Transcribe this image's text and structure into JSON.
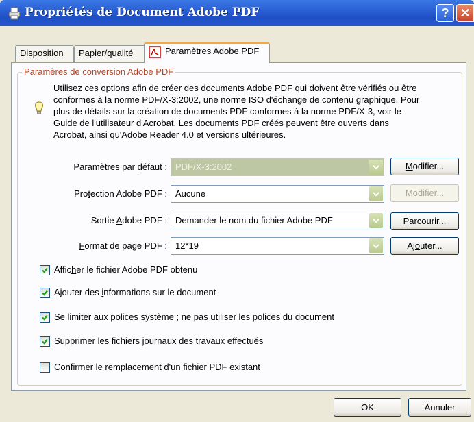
{
  "window": {
    "title": "Propriétés de Document Adobe PDF",
    "help_label": "?",
    "close_label": "✕"
  },
  "tabs": [
    {
      "label": "Disposition"
    },
    {
      "label": "Papier/qualité"
    },
    {
      "label": "Paramètres Adobe PDF",
      "active": true
    }
  ],
  "group": {
    "legend": "Paramères de conversion Adobe PDF",
    "info_lines": [
      "Utilisez ces options afin de créer des documents Adobe PDF qui doivent être vérifiés ou être",
      "conformes à la norme PDF/X-3:2002, une norme ISO d'échange de contenu graphique. Pour",
      "plus de détails sur la création de documents PDF conformes à la norme PDF/X-3, voir le",
      "Guide de l'utilisateur d'Acrobat. Les documents PDF créés peuvent être ouverts dans",
      "Acrobat, ainsi qu'Adobe Reader 4.0 et versions ultérieures."
    ]
  },
  "rows": [
    {
      "label_pre": "Paramètres par ",
      "label_u": "d",
      "label_post": "éfaut :",
      "value": "PDF/X-3:2002",
      "disabled_combo": true,
      "btn_pre": "",
      "btn_u": "M",
      "btn_post": "odifier...",
      "btn_disabled": false
    },
    {
      "label_pre": "Pro",
      "label_u": "t",
      "label_post": "ection Adobe PDF :",
      "value": "Aucune",
      "disabled_combo": false,
      "btn_pre": "M",
      "btn_u": "o",
      "btn_post": "difier...",
      "btn_disabled": true
    },
    {
      "label_pre": "Sortie ",
      "label_u": "A",
      "label_post": "dobe PDF :",
      "value": "Demander le nom du fichier Adobe PDF",
      "disabled_combo": false,
      "btn_pre": "",
      "btn_u": "P",
      "btn_post": "arcourir...",
      "btn_disabled": false
    },
    {
      "label_pre": "",
      "label_u": "F",
      "label_post": "ormat de page PDF :",
      "value": "12*19",
      "disabled_combo": false,
      "btn_pre": "Aj",
      "btn_u": "o",
      "btn_post": "uter...",
      "btn_disabled": false
    }
  ],
  "checkboxes": [
    {
      "pre": "Affic",
      "u": "h",
      "post": "er le fichier Adobe PDF obtenu",
      "checked": true
    },
    {
      "pre": "Ajouter des ",
      "u": "i",
      "post": "nformations sur le document",
      "checked": true
    },
    {
      "pre": "Se limiter aux polices système ; ",
      "u": "n",
      "post": "e pas utiliser les polices du document",
      "checked": true
    },
    {
      "pre": "",
      "u": "S",
      "post": "upprimer les fichiers journaux des travaux effectués",
      "checked": true
    },
    {
      "pre": "Confirmer le ",
      "u": "r",
      "post": "emplacement d'un fichier PDF existant",
      "checked": false
    }
  ],
  "footer": {
    "ok_label": "OK",
    "cancel_label": "Annuler"
  },
  "colors": {
    "titlebar": "#2a5fd4",
    "legend": "#b0462a",
    "check": "#21a121",
    "tab_highlight": "#f7a83c"
  }
}
